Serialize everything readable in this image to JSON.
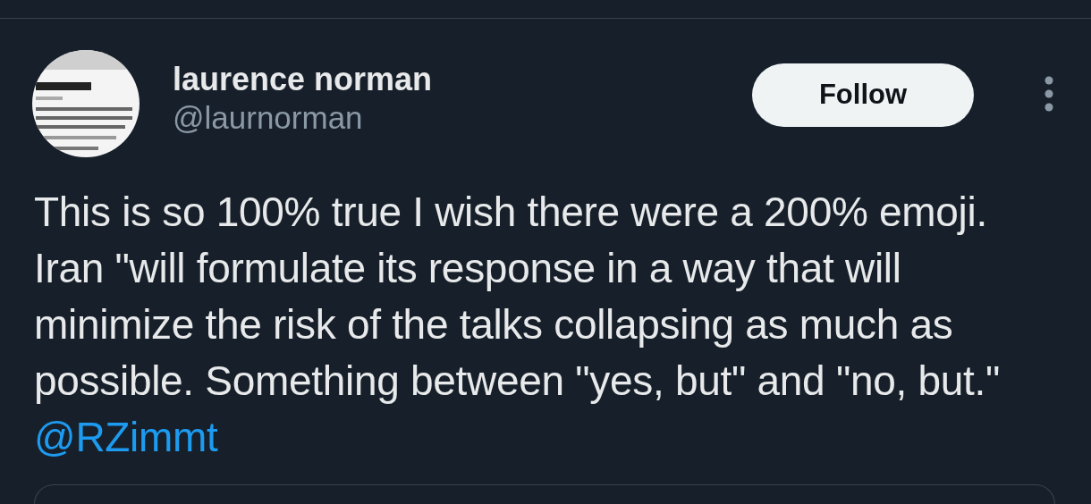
{
  "author": {
    "name": "laurence norman",
    "handle": "@laurnorman"
  },
  "follow_button": {
    "label": "Follow"
  },
  "tweet": {
    "text": "This is so 100% true I wish there were a 200% emoji.  Iran \"will formulate its response in a way that will minimize the risk of the talks collapsing as much as possible. Something between \"yes, but\" and \"no, but.\"",
    "mention": "@RZimmt"
  }
}
